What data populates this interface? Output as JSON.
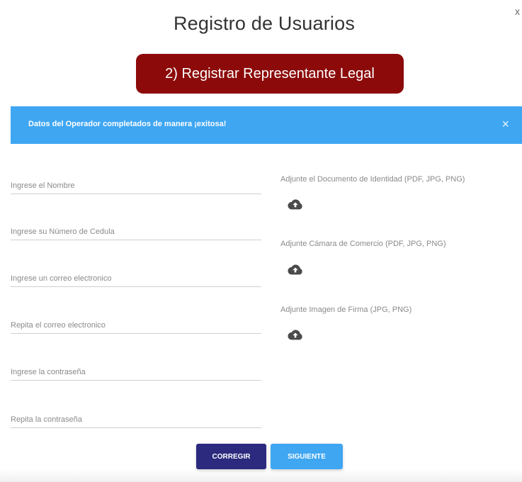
{
  "window": {
    "close_glyph": "x"
  },
  "header": {
    "title": "Registro de Usuarios",
    "step_label": "2) Registrar Representante Legal"
  },
  "alert": {
    "message": "Datos del Operador completados de manera ¡exitosa!",
    "close_glyph": "×"
  },
  "form": {
    "fields": [
      {
        "placeholder": "Ingrese el Nombre",
        "value": ""
      },
      {
        "placeholder": "Ingrese su Número de Cedula",
        "value": ""
      },
      {
        "placeholder": "Ingrese un correo electronico",
        "value": ""
      },
      {
        "placeholder": "Repita el correo electronico",
        "value": ""
      },
      {
        "placeholder": "Ingrese la contraseña",
        "value": ""
      },
      {
        "placeholder": "Repita la contraseña",
        "value": ""
      }
    ],
    "uploads": [
      {
        "label": "Adjunte el Documento de Identidad (PDF, JPG, PNG)",
        "icon": "cloud-upload-icon"
      },
      {
        "label": "Adjunte Cámara de Comercio (PDF, JPG, PNG)",
        "icon": "cloud-upload-icon"
      },
      {
        "label": "Adjunte Imagen de Firma (JPG, PNG)",
        "icon": "cloud-upload-icon"
      }
    ]
  },
  "actions": {
    "corregir_label": "CORREGIR",
    "siguiente_label": "SIGUIENTE"
  },
  "colors": {
    "step_pill": "#8c0a0a",
    "alert_bg": "#3fa6f2",
    "corregir_bg": "#2b2a7e",
    "siguiente_bg": "#3fa6f2",
    "icon": "#4a4a4a"
  }
}
